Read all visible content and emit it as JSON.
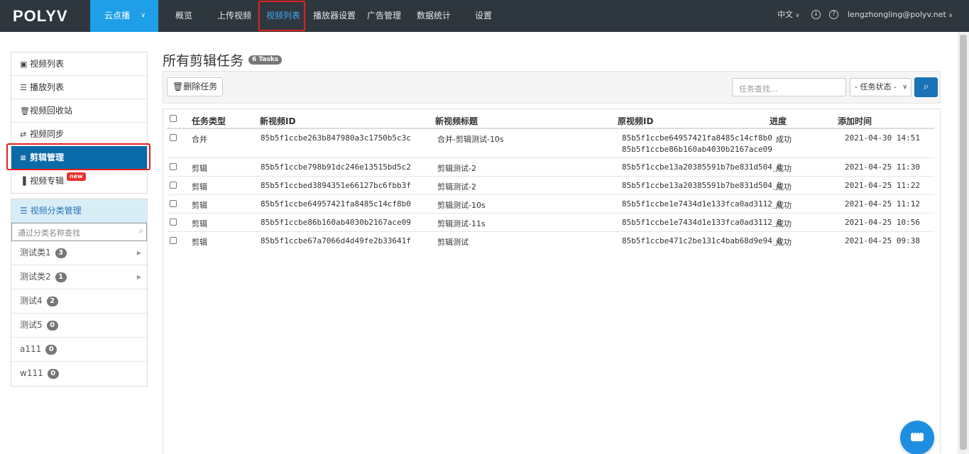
{
  "topbar": {
    "logo": "POLYV",
    "product": "云点播",
    "nav": [
      "概览",
      "上传视频",
      "视频列表",
      "播放器设置",
      "广告管理",
      "数据统计",
      "设置"
    ],
    "active_nav": "视频列表",
    "language": "中文",
    "user": "lengzhongling@polyv.net"
  },
  "sidebar": {
    "items": [
      {
        "icon": "film-icon",
        "label": "视频列表"
      },
      {
        "icon": "list-icon",
        "label": "播放列表"
      },
      {
        "icon": "trash-icon",
        "label": "视频回收站"
      },
      {
        "icon": "sync-icon",
        "label": "视频同步"
      },
      {
        "icon": "edit-icon",
        "label": "剪辑管理"
      },
      {
        "icon": "columns-icon",
        "label": "视频专辑"
      }
    ],
    "active": "剪辑管理",
    "new_badge": "new"
  },
  "categories": {
    "title": "视频分类管理",
    "search_placeholder": "通过分类名称查找",
    "items": [
      {
        "name": "测试类1",
        "count": "3",
        "has_children": true
      },
      {
        "name": "测试类2",
        "count": "1",
        "has_children": true
      },
      {
        "name": "测试4",
        "count": "2",
        "has_children": false
      },
      {
        "name": "测试5",
        "count": "0",
        "has_children": false
      },
      {
        "name": "a111",
        "count": "0",
        "has_children": false
      },
      {
        "name": "w111",
        "count": "0",
        "has_children": false
      }
    ]
  },
  "main": {
    "title": "所有剪辑任务",
    "tasks_badge": "6 Tasks",
    "delete_button": "删除任务",
    "search_placeholder": "任务查找...",
    "status_select": "- 任务状态 -"
  },
  "table": {
    "headers": [
      "任务类型",
      "新视频ID",
      "新视频标题",
      "原视频ID",
      "进度",
      "添加时间"
    ],
    "rows": [
      {
        "type": "合并",
        "new_id": "85b5f1ccbe263b847980a3c1750b5c3c",
        "title": "合并-剪辑测试-10s",
        "orig_ids": [
          "85b5f1ccbe64957421fa8485c14cf8b0",
          "85b5f1ccbe86b160ab4030b2167ace09"
        ],
        "progress": "成功",
        "time": "2021-04-30 14:51"
      },
      {
        "type": "剪辑",
        "new_id": "85b5f1ccbe798b91dc246e13515bd5c2",
        "title": "剪辑测试-2",
        "orig_ids": [
          "85b5f1ccbe13a20385591b7be831d504_8"
        ],
        "progress": "成功",
        "time": "2021-04-25 11:30"
      },
      {
        "type": "剪辑",
        "new_id": "85b5f1ccbed3894351e66127bc6fbb3f",
        "title": "剪辑测试-2",
        "orig_ids": [
          "85b5f1ccbe13a20385591b7be831d504_8"
        ],
        "progress": "成功",
        "time": "2021-04-25 11:22"
      },
      {
        "type": "剪辑",
        "new_id": "85b5f1ccbe64957421fa8485c14cf8b0",
        "title": "剪辑测试-10s",
        "orig_ids": [
          "85b5f1ccbe1e7434d1e133fca0ad3112_8"
        ],
        "progress": "成功",
        "time": "2021-04-25 11:12"
      },
      {
        "type": "剪辑",
        "new_id": "85b5f1ccbe86b160ab4030b2167ace09",
        "title": "剪辑测试-11s",
        "orig_ids": [
          "85b5f1ccbe1e7434d1e133fca0ad3112_8"
        ],
        "progress": "成功",
        "time": "2021-04-25 10:56"
      },
      {
        "type": "剪辑",
        "new_id": "85b5f1ccbe67a7066d4d49fe2b33641f",
        "title": "剪辑测试",
        "orig_ids": [
          "85b5f1ccbe471c2be131c4bab68d9e94_8"
        ],
        "progress": "成功",
        "time": "2021-04-25 09:38"
      }
    ]
  }
}
